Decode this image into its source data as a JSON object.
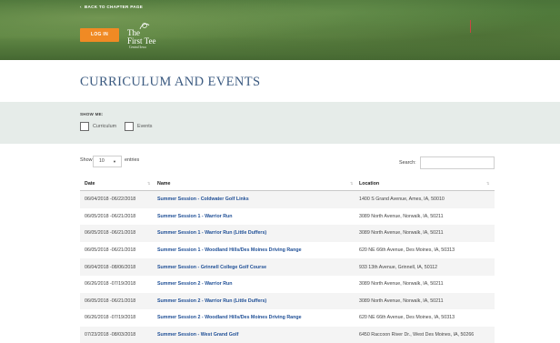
{
  "header": {
    "back_label": "BACK TO CHAPTER PAGE",
    "login_label": "LOG IN",
    "logo": {
      "line1": "The",
      "line2": "First Tee",
      "line3": "Central Iowa"
    }
  },
  "page": {
    "title": "CURRICULUM AND EVENTS"
  },
  "filters": {
    "show_me_label": "SHOW ME:",
    "options": [
      {
        "label": "Curriculum",
        "checked": false
      },
      {
        "label": "Events",
        "checked": false
      }
    ]
  },
  "table_controls": {
    "show_label": "Show",
    "entries_value": "10",
    "entries_label": "entries",
    "search_label": "Search:",
    "search_value": ""
  },
  "table": {
    "columns": [
      "Date",
      "Name",
      "Location"
    ],
    "rows": [
      {
        "date": "06/04/2018 -06/22/2018",
        "name": "Summer Session - Coldwater Golf Links",
        "location": "1400 S Grand Avenue, Ames, IA, 50010"
      },
      {
        "date": "06/05/2018 -06/21/2018",
        "name": "Summer Session 1 - Warrior Run",
        "location": "3089 North Avenue, Norwalk, IA, 50211"
      },
      {
        "date": "06/05/2018 -06/21/2018",
        "name": "Summer Session 1 - Warrior Run (Little Duffers)",
        "location": "3089 North Avenue, Norwalk, IA, 50211"
      },
      {
        "date": "06/05/2018 -06/21/2018",
        "name": "Summer Session 1 - Woodland Hills/Des Moines Driving Range",
        "location": "620 NE 66th Avenue, Des Moines, IA, 50313"
      },
      {
        "date": "06/04/2018 -08/06/2018",
        "name": "Summer Session - Grinnell College Golf Course",
        "location": "933 13th Avenue, Grinnell, IA, 50112"
      },
      {
        "date": "06/26/2018 -07/19/2018",
        "name": "Summer Session 2 - Warrior Run",
        "location": "3089 North Avenue, Norwalk, IA, 50211"
      },
      {
        "date": "06/05/2018 -06/21/2018",
        "name": "Summer Session 2 - Warrior Run (Little Duffers)",
        "location": "3089 North Avenue, Norwalk, IA, 50211"
      },
      {
        "date": "06/26/2018 -07/19/2018",
        "name": "Summer Session 2 - Woodland Hills/Des Moines Driving Range",
        "location": "620 NE 66th Avenue, Des Moines, IA, 50313"
      },
      {
        "date": "07/23/2018 -08/03/2018",
        "name": "Summer Session - West Grand Golf",
        "location": "6450 Raccoon River Dr., West Des Moines, IA, 50266"
      }
    ]
  },
  "colors": {
    "accent": "#f08a24",
    "title": "#3b5a80",
    "link": "#1f4f96",
    "panel": "#e6ece9"
  }
}
